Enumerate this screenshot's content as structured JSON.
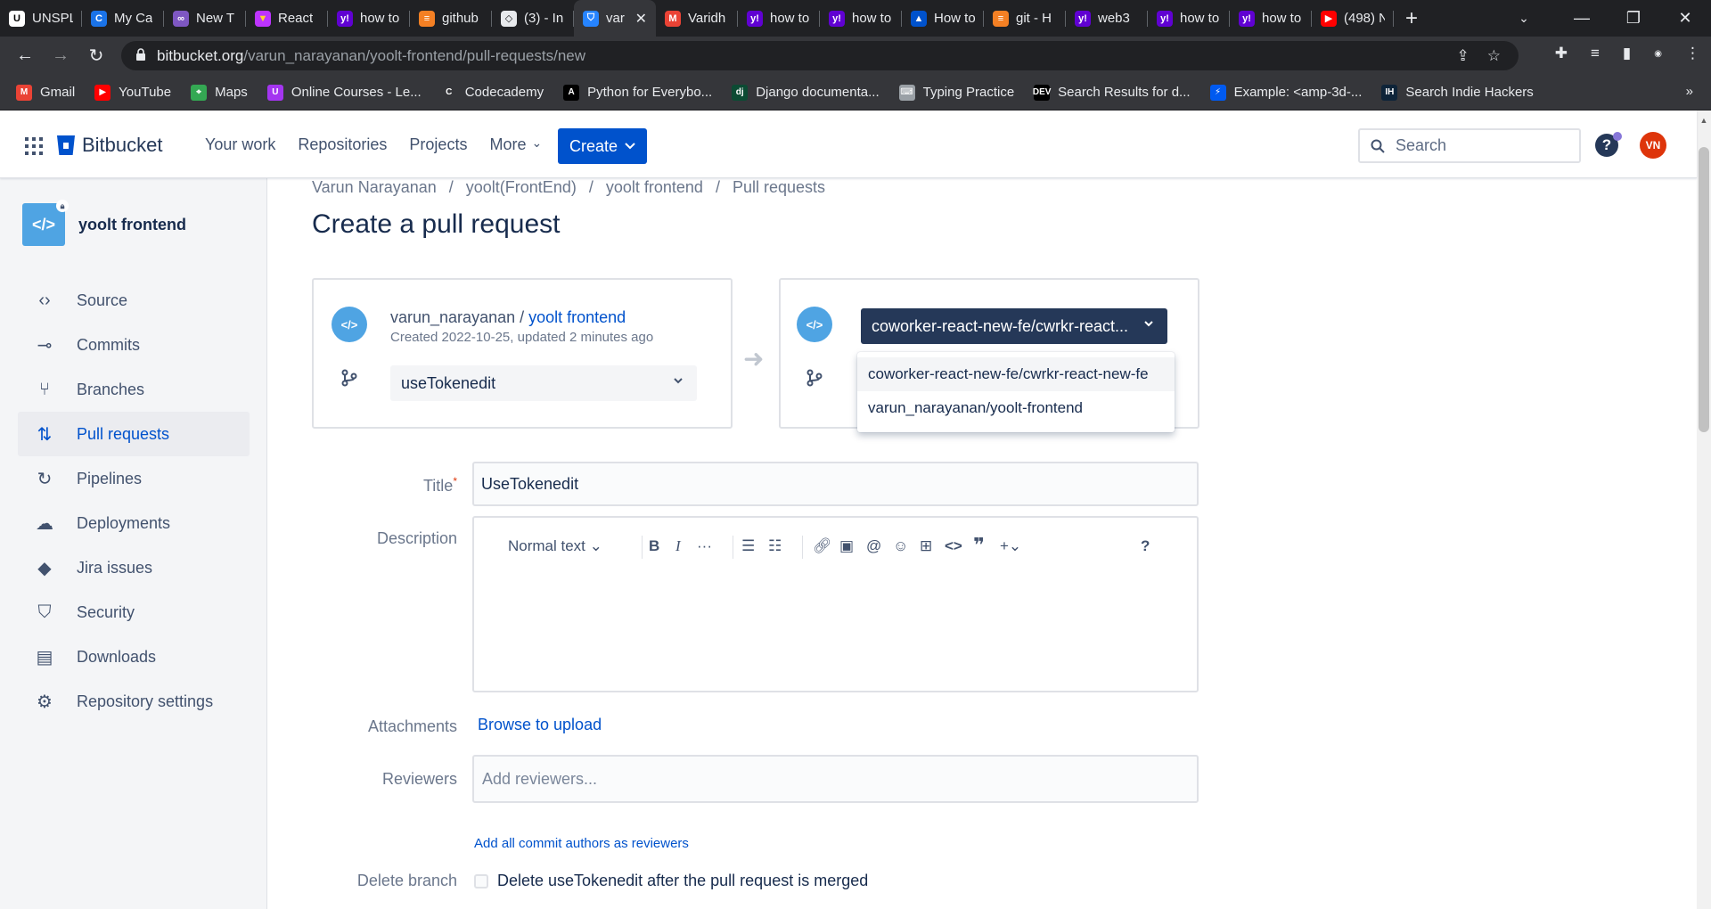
{
  "browser": {
    "tabs": [
      {
        "title": "UNSPLASH",
        "fav": "U",
        "color": "#ffffff",
        "fg": "#000000"
      },
      {
        "title": "My Ca",
        "fav": "C",
        "color": "#1a73e8",
        "fg": "#ffffff"
      },
      {
        "title": "New T",
        "fav": "∞",
        "color": "#7e57c2",
        "fg": "#ffffff"
      },
      {
        "title": "React",
        "fav": "▼",
        "color": "#bd34fe",
        "fg": "#ffd62e"
      },
      {
        "title": "how to",
        "fav": "y!",
        "color": "#6001d2",
        "fg": "#ffffff"
      },
      {
        "title": "github",
        "fav": "≡",
        "color": "#f48024",
        "fg": "#ffffff"
      },
      {
        "title": "(3) - In",
        "fav": "◇",
        "color": "#e8eaed",
        "fg": "#202124"
      },
      {
        "title": "var",
        "fav": "⛉",
        "color": "#2684ff",
        "fg": "#ffffff",
        "active": true
      },
      {
        "title": "Varidh",
        "fav": "M",
        "color": "#ea4335",
        "fg": "#ffffff"
      },
      {
        "title": "how to",
        "fav": "y!",
        "color": "#6001d2",
        "fg": "#ffffff"
      },
      {
        "title": "how to",
        "fav": "y!",
        "color": "#6001d2",
        "fg": "#ffffff"
      },
      {
        "title": "How to",
        "fav": "▲",
        "color": "#0052cc",
        "fg": "#ffffff"
      },
      {
        "title": "git - H",
        "fav": "≡",
        "color": "#f48024",
        "fg": "#ffffff"
      },
      {
        "title": "web3",
        "fav": "y!",
        "color": "#6001d2",
        "fg": "#ffffff"
      },
      {
        "title": "how to",
        "fav": "y!",
        "color": "#6001d2",
        "fg": "#ffffff"
      },
      {
        "title": "how to",
        "fav": "y!",
        "color": "#6001d2",
        "fg": "#ffffff"
      },
      {
        "title": "(498) N",
        "fav": "▶",
        "color": "#ff0000",
        "fg": "#ffffff"
      }
    ],
    "url_host": "bitbucket.org",
    "url_path": "/varun_narayanan/yoolt-frontend/pull-requests/new",
    "bookmarks": [
      {
        "label": "Gmail",
        "fav": "M",
        "color": "#ea4335"
      },
      {
        "label": "YouTube",
        "fav": "▶",
        "color": "#ff0000"
      },
      {
        "label": "Maps",
        "fav": "⌖",
        "color": "#34a853"
      },
      {
        "label": "Online Courses - Le...",
        "fav": "U",
        "color": "#a435f0"
      },
      {
        "label": "Codecademy",
        "fav": "C",
        "color": "#35363a"
      },
      {
        "label": "Python for Everybo...",
        "fav": "A",
        "color": "#000000"
      },
      {
        "label": "Django documenta...",
        "fav": "dj",
        "color": "#0c4b33"
      },
      {
        "label": "Typing Practice",
        "fav": "⌨",
        "color": "#9aa0a6"
      },
      {
        "label": "Search Results for d...",
        "fav": "DEV",
        "color": "#000000"
      },
      {
        "label": "Example: <amp-3d-...",
        "fav": "⚡",
        "color": "#005af0"
      },
      {
        "label": "Search Indie Hackers",
        "fav": "IH",
        "color": "#0e2439"
      }
    ],
    "bookmarks_more": "»"
  },
  "header": {
    "product": "Bitbucket",
    "nav": [
      "Your work",
      "Repositories",
      "Projects",
      "More"
    ],
    "create_label": "Create",
    "search_placeholder": "Search",
    "help": "?",
    "avatar_initials": "VN"
  },
  "sidebar": {
    "repo_name": "yoolt frontend",
    "items": [
      {
        "label": "Source",
        "icon": "‹›"
      },
      {
        "label": "Commits",
        "icon": "⊸"
      },
      {
        "label": "Branches",
        "icon": "⑂"
      },
      {
        "label": "Pull requests",
        "icon": "⇅",
        "active": true
      },
      {
        "label": "Pipelines",
        "icon": "↻"
      },
      {
        "label": "Deployments",
        "icon": "☁"
      },
      {
        "label": "Jira issues",
        "icon": "◆"
      },
      {
        "label": "Security",
        "icon": "⛉"
      },
      {
        "label": "Downloads",
        "icon": "▤"
      },
      {
        "label": "Repository settings",
        "icon": "⚙"
      }
    ]
  },
  "main": {
    "breadcrumbs": [
      "Varun Narayanan",
      "yoolt(FrontEnd)",
      "yoolt frontend",
      "Pull requests"
    ],
    "title": "Create a pull request",
    "source": {
      "owner": "varun_narayanan",
      "slash": " / ",
      "repo": "yoolt frontend",
      "meta": "Created 2022-10-25, updated 2 minutes ago",
      "branch": "useTokenedit"
    },
    "destination": {
      "selected": "coworker-react-new-fe/cwrkr-react...",
      "options": [
        "coworker-react-new-fe/cwrkr-react-new-fe",
        "varun_narayanan/yoolt-frontend"
      ]
    },
    "form": {
      "title_label": "Title",
      "title_required": "*",
      "title_value": "UseTokenedit",
      "description_label": "Description",
      "editor_style": "Normal text",
      "attachments_label": "Attachments",
      "browse_label": "Browse to upload",
      "reviewers_label": "Reviewers",
      "reviewers_placeholder": "Add reviewers...",
      "add_authors": "Add all commit authors as reviewers",
      "delete_branch_label": "Delete branch",
      "delete_branch_text": "Delete useTokenedit after the pull request is merged"
    }
  }
}
